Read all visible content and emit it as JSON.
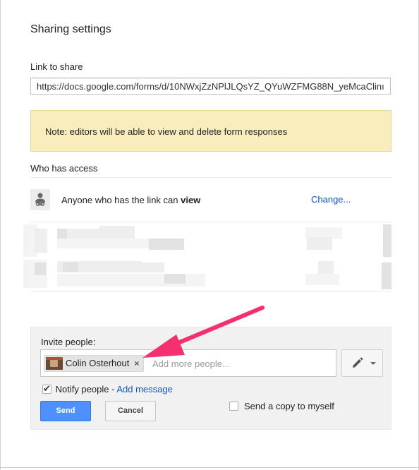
{
  "dialog": {
    "title": "Sharing settings"
  },
  "link": {
    "label": "Link to share",
    "value": "https://docs.google.com/forms/d/10NWxjZzNPlJLQsYZ_QYuWZFMG88N_yeMcaClinı"
  },
  "note": {
    "text": "Note: editors will be able to view and delete form responses"
  },
  "access": {
    "label": "Who has access",
    "entry_text": "Anyone who has the link can ",
    "entry_level": "view",
    "change_label": "Change..."
  },
  "invite": {
    "label": "Invite people:",
    "chip_name": "Colin Osterhout",
    "chip_close": "×",
    "placeholder": "Add more people...",
    "notify_label": "Notify people - ",
    "notify_checked": true,
    "add_message": "Add message",
    "send_label": "Send",
    "cancel_label": "Cancel",
    "copy_label": "Send a copy to myself",
    "copy_checked": false
  },
  "colors": {
    "accent": "#4d90fe",
    "link": "#1155cc",
    "note_bg": "#f9edbe",
    "annotation_arrow": "#f5306e"
  },
  "icons": {
    "access": "person-link-icon",
    "permission": "pencil-icon",
    "permission_caret": "chevron-down-icon",
    "annotation": "arrow-annotation"
  }
}
